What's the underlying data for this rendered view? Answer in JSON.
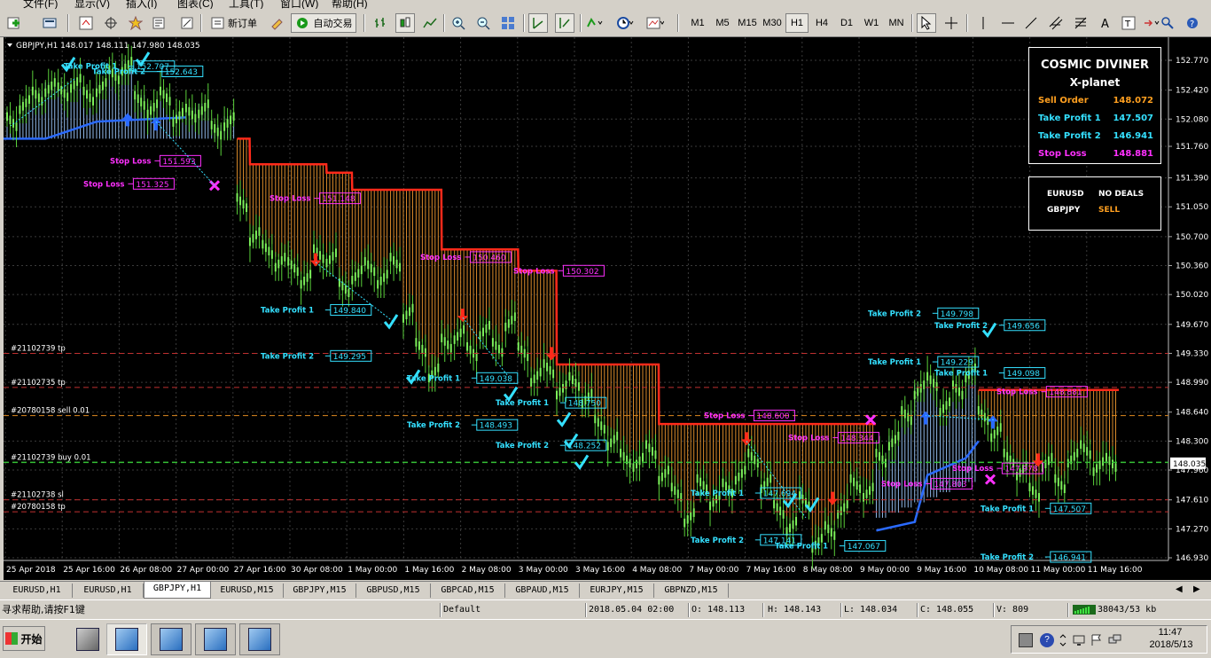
{
  "menu": [
    {
      "label": "文件(F)"
    },
    {
      "label": "显示(V)"
    },
    {
      "label": "插入(I)"
    },
    {
      "label": "图表(C)"
    },
    {
      "label": "工具(T)"
    },
    {
      "label": "窗口(W)"
    },
    {
      "label": "帮助(H)"
    }
  ],
  "toolbar": {
    "new_order_label": "新订单",
    "auto_trade_label": "自动交易",
    "timeframes": [
      "M1",
      "M5",
      "M15",
      "M30",
      "H1",
      "H4",
      "D1",
      "W1",
      "MN"
    ],
    "active_timeframe": "H1"
  },
  "chart": {
    "header": "GBPJPY,H1  148.017 148.111 147.980 148.035",
    "current_price": "148.035",
    "price_axis": [
      "152.770",
      "152.420",
      "152.080",
      "151.760",
      "151.390",
      "151.050",
      "150.700",
      "150.360",
      "150.020",
      "149.670",
      "149.330",
      "148.990",
      "148.640",
      "148.300",
      "147.960",
      "147.610",
      "147.270",
      "146.930"
    ],
    "time_axis": [
      "25 Apr 2018",
      "25 Apr 16:00",
      "26 Apr 08:00",
      "27 Apr 00:00",
      "27 Apr 16:00",
      "30 Apr 08:00",
      "1 May 00:00",
      "1 May 16:00",
      "2 May 08:00",
      "3 May 00:00",
      "3 May 16:00",
      "4 May 08:00",
      "7 May 00:00",
      "7 May 16:00",
      "8 May 08:00",
      "9 May 00:00",
      "9 May 16:00",
      "10 May 08:00",
      "11 May 00:00",
      "11 May 16:00"
    ],
    "order_lines": [
      {
        "label": "#21102739 tp",
        "color": "#c03030"
      },
      {
        "label": "#21102735 tp",
        "color": "#c03030"
      },
      {
        "label": "#20780158 sell 0.01",
        "color": "#e08a20"
      },
      {
        "label": "#21102739 buy 0.01",
        "color": "#35c035"
      },
      {
        "label": "#21102738 sl",
        "color": "#c03030"
      },
      {
        "label": "#20780158 tp",
        "color": "#c03030"
      }
    ],
    "annotations": [
      {
        "text": "Take Profit 1",
        "value": "152.707",
        "color": "#34e0ff"
      },
      {
        "text": "Take Profit 2",
        "value": "152.643",
        "color": "#34e0ff"
      },
      {
        "text": "Stop Loss",
        "value": "151.325",
        "color": "#ff30ff"
      },
      {
        "text": "Stop Loss",
        "value": "151.593",
        "color": "#ff30ff"
      },
      {
        "text": "Stop Loss",
        "value": "151.148",
        "color": "#ff30ff"
      },
      {
        "text": "Stop Loss",
        "value": "150.460",
        "color": "#ff30ff"
      },
      {
        "text": "Stop Loss",
        "value": "150.302",
        "color": "#ff30ff"
      },
      {
        "text": "Take Profit 1",
        "value": "149.840",
        "color": "#34e0ff"
      },
      {
        "text": "Take Profit 2",
        "value": "149.295",
        "color": "#34e0ff"
      },
      {
        "text": "Take Profit 1",
        "value": "149.038",
        "color": "#34e0ff"
      },
      {
        "text": "Take Profit 1",
        "value": "148.750",
        "color": "#34e0ff"
      },
      {
        "text": "Take Profit 2",
        "value": "148.493",
        "color": "#34e0ff"
      },
      {
        "text": "Take Profit 2",
        "value": "148.252",
        "color": "#34e0ff"
      },
      {
        "text": "Take Profit 1",
        "value": "147.694",
        "color": "#34e0ff"
      },
      {
        "text": "Take Profit 2",
        "value": "147.141",
        "color": "#34e0ff"
      },
      {
        "text": "Take Profit 1",
        "value": "147.067",
        "color": "#34e0ff"
      },
      {
        "text": "Stop Loss",
        "value": "148.600",
        "color": "#ff30ff"
      },
      {
        "text": "Stop Loss",
        "value": "148.344",
        "color": "#ff30ff"
      },
      {
        "text": "Stop Loss",
        "value": "147.803",
        "color": "#ff30ff"
      },
      {
        "text": "Take Profit 2",
        "value": "149.798",
        "color": "#34e0ff"
      },
      {
        "text": "Take Profit 2",
        "value": "149.656",
        "color": "#34e0ff"
      },
      {
        "text": "Take Profit 1",
        "value": "149.229",
        "color": "#34e0ff"
      },
      {
        "text": "Take Profit 1",
        "value": "149.098",
        "color": "#34e0ff"
      },
      {
        "text": "Stop Loss",
        "value": "148.881",
        "color": "#ff30ff"
      },
      {
        "text": "Stop Loss",
        "value": "147.978",
        "color": "#ff30ff"
      },
      {
        "text": "Take Profit 1",
        "value": "147.507",
        "color": "#34e0ff"
      },
      {
        "text": "Take Profit 2",
        "value": "146.941",
        "color": "#34e0ff"
      }
    ]
  },
  "info_panel": {
    "title": "COSMIC DIVINER",
    "subtitle": "X-planet",
    "rows": [
      {
        "label": "Sell Order",
        "value": "148.072",
        "color": "#ffa020"
      },
      {
        "label": "Take Profit 1",
        "value": "147.507",
        "color": "#34e0ff"
      },
      {
        "label": "Take Profit 2",
        "value": "146.941",
        "color": "#34e0ff"
      },
      {
        "label": "Stop Loss",
        "value": "148.881",
        "color": "#ff30ff"
      }
    ]
  },
  "deals_panel": {
    "rows": [
      {
        "pair": "EURUSD",
        "status": "NO DEALS",
        "color": "#ffffff"
      },
      {
        "pair": "GBPJPY",
        "status": "SELL",
        "color": "#ffa020"
      }
    ]
  },
  "chart_tabs": [
    "EURUSD,H1",
    "EURUSD,H1",
    "GBPJPY,H1",
    "EURUSD,M15",
    "GBPJPY,M15",
    "GBPUSD,M15",
    "GBPCAD,M15",
    "GBPAUD,M15",
    "EURJPY,M15",
    "GBPNZD,M15"
  ],
  "active_tab_index": 2,
  "status": {
    "help": "寻求帮助,请按F1键",
    "profile": "Default",
    "datetime": "2018.05.04 02:00",
    "open": "O: 148.113",
    "high": "H: 148.143",
    "low": "L: 148.034",
    "close": "C: 148.055",
    "volume": "V: 809",
    "traffic": "38043/53 kb"
  },
  "taskbar": {
    "start_label": "开始",
    "time": "11:47",
    "date": "2018/5/13"
  }
}
